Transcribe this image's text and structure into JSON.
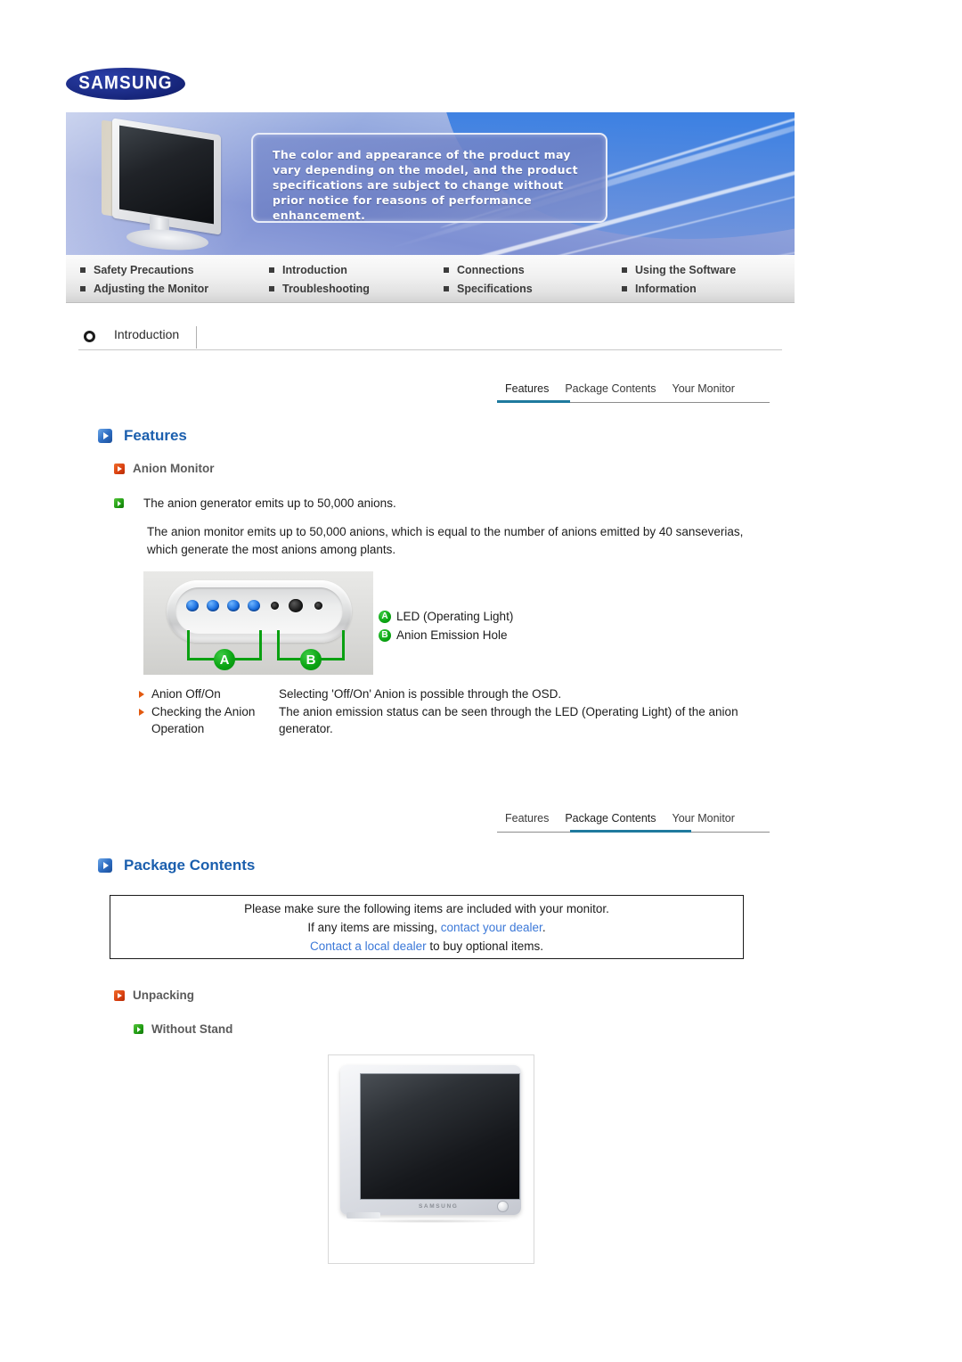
{
  "brand": {
    "logo_text": "SAMSUNG"
  },
  "banner": {
    "notice": "The color and appearance of the product may vary depending on the model, and the product specifications are subject to change without prior notice for reasons of performance enhancement."
  },
  "nav": {
    "items": [
      "Safety Precautions",
      "Introduction",
      "Connections",
      "Using the Software",
      "Adjusting the Monitor",
      "Troubleshooting",
      "Specifications",
      "Information"
    ]
  },
  "section": {
    "title": "Introduction"
  },
  "tabs_top": {
    "items": [
      "Features",
      "Package Contents",
      "Your Monitor"
    ],
    "active": "Features"
  },
  "tabs_bottom": {
    "items": [
      "Features",
      "Package Contents",
      "Your Monitor"
    ],
    "active": "Package Contents"
  },
  "features": {
    "heading": "Features",
    "subheading": "Anion Monitor",
    "bullet": "The anion generator emits up to 50,000 anions.",
    "paragraph": "The anion monitor emits up to 50,000 anions, which is equal to the number of anions emitted by 40 sanseverias, which generate the most anions among plants.",
    "photo": {
      "bracket_a_label": "A",
      "bracket_b_label": "B"
    },
    "legend": [
      {
        "badge": "A",
        "text": "LED (Operating Light)"
      },
      {
        "badge": "B",
        "text": "Anion Emission Hole"
      }
    ],
    "rows": [
      {
        "term": "Anion Off/On",
        "desc": "Selecting 'Off/On' Anion is possible through the OSD."
      },
      {
        "term": "Checking the Anion Operation",
        "desc": "The anion emission status can be seen through the LED (Operating Light) of the anion generator."
      }
    ]
  },
  "package": {
    "heading": "Package Contents",
    "note_line1": "Please make sure the following items are included with your monitor.",
    "note_line2_pre": "If any items are missing, ",
    "note_line2_link": "contact your dealer",
    "note_line2_post": ".",
    "note_line3_link": "Contact a local dealer",
    "note_line3_post": " to buy optional items.",
    "unpacking_heading": "Unpacking",
    "without_stand_heading": "Without Stand",
    "monitor_brand_label": "SAMSUNG"
  },
  "colors": {
    "heading_blue": "#1b5fae",
    "link_blue": "#3b78d8",
    "accent_orange": "#d93f10",
    "accent_green": "#0ba513",
    "tab_active": "#1f7a9e",
    "logo_navy": "#16257a"
  }
}
